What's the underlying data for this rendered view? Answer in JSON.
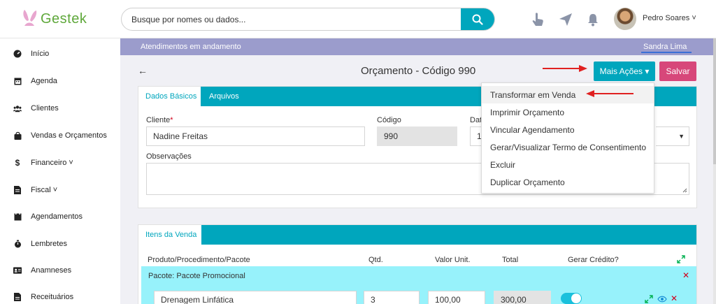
{
  "app": {
    "brand": "Gestek",
    "brand_color": "#5fa83b",
    "accent": "#00a6bd",
    "danger": "#d7477a"
  },
  "topbar": {
    "search_placeholder": "Busque por nomes ou dados...",
    "search_icon": "search-icon",
    "icons": [
      "hand-pointer-icon",
      "paper-plane-icon",
      "bell-icon"
    ],
    "user_name": "Pedro Soares ˅"
  },
  "sidebar": {
    "items": [
      {
        "label": "Início",
        "icon": "dashboard-icon"
      },
      {
        "label": "Agenda",
        "icon": "calendar-icon"
      },
      {
        "label": "Clientes",
        "icon": "users-icon"
      },
      {
        "label": "Vendas e Orçamentos",
        "icon": "shopping-bag-icon"
      },
      {
        "label": "Financeiro ˅",
        "icon": "dollar-icon"
      },
      {
        "label": "Fiscal ˅",
        "icon": "file-icon"
      },
      {
        "label": "Agendamentos",
        "icon": "calendar-list-icon"
      },
      {
        "label": "Lembretes",
        "icon": "stopwatch-icon"
      },
      {
        "label": "Anamneses",
        "icon": "id-card-icon"
      },
      {
        "label": "Receituários",
        "icon": "file-text-icon"
      }
    ]
  },
  "strip": {
    "left": "Atendimentos em andamento",
    "right": "Sandra Lima"
  },
  "header": {
    "title": "Orçamento - Código 990",
    "more_actions": "Mais Ações ▾",
    "save": "Salvar"
  },
  "card1": {
    "tabs": [
      "Dados Básicos",
      "Arquivos"
    ],
    "cliente_label": "Cliente",
    "cliente_required": "*",
    "cliente_value": "Nadine Freitas",
    "codigo_label": "Código",
    "codigo_value": "990",
    "data_label": "Dat",
    "data_value": "1",
    "observacoes_label": "Observações"
  },
  "dropdown": {
    "items": [
      "Transformar em Venda",
      "Imprimir Orçamento",
      "Vincular Agendamento",
      "Gerar/Visualizar Termo de Consentimento",
      "Excluir",
      "Duplicar Orçamento"
    ]
  },
  "card2": {
    "tab": "Itens da Venda",
    "columns": [
      "Produto/Procedimento/Pacote",
      "Qtd.",
      "Valor Unit.",
      "Total",
      "Gerar Crédito?"
    ],
    "pacote_label": "Pacote: Pacote Promocional",
    "row": {
      "produto": "Drenagem Linfática",
      "qtd": "3",
      "valor_unit": "100,00",
      "total": "300,00",
      "gerar_credito": true
    }
  }
}
